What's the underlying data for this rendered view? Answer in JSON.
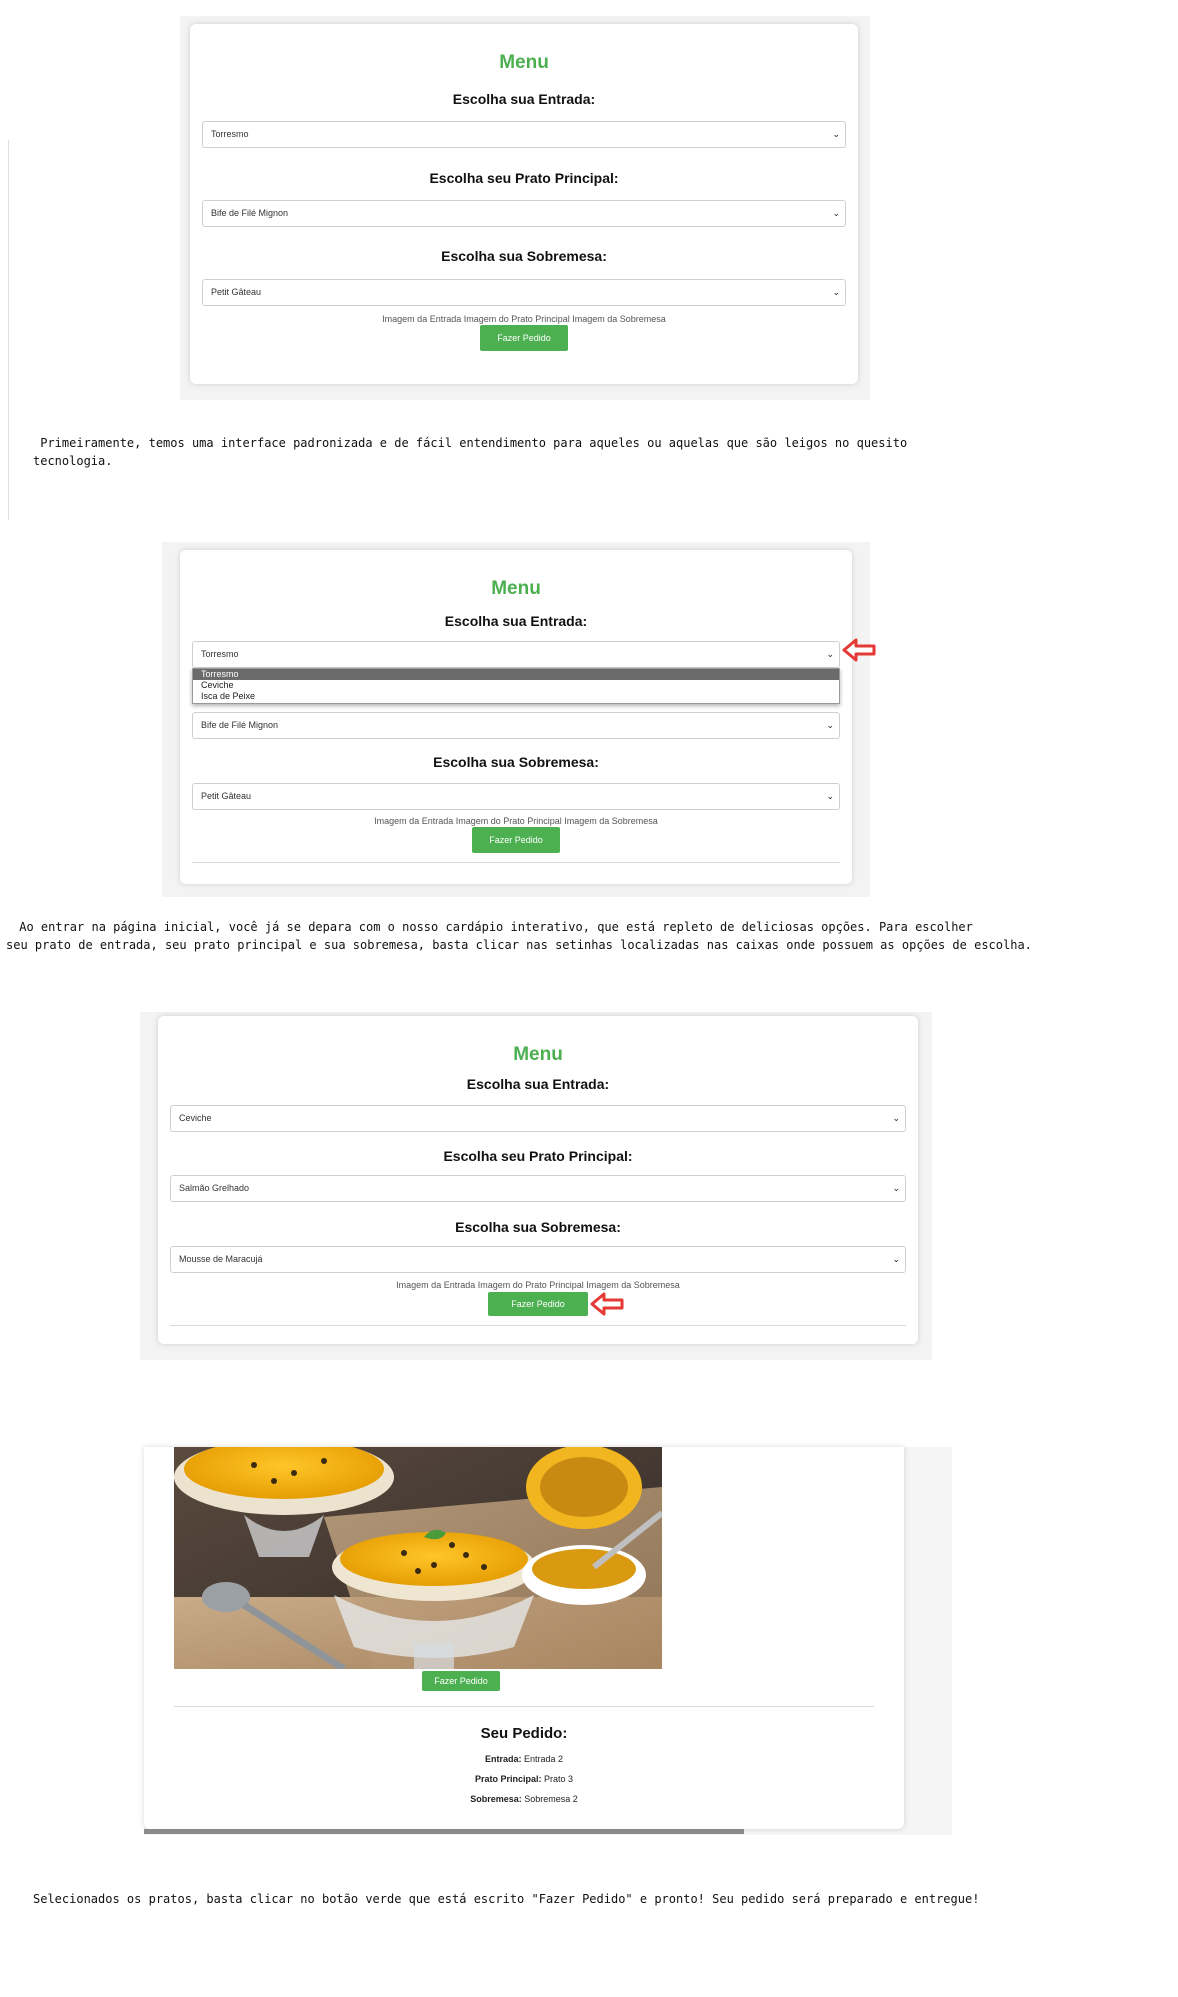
{
  "menu": {
    "title": "Menu",
    "label_entrada": "Escolha sua Entrada:",
    "label_principal": "Escolha seu Prato Principal:",
    "label_sobremesa": "Escolha sua Sobremesa:",
    "img_alts": "Imagem da Entrada Imagem do Prato Principal Imagem da Sobremesa",
    "order_button": "Fazer Pedido"
  },
  "shot1": {
    "entrada": "Torresmo",
    "principal": "Bife de Filé Mignon",
    "sobremesa": "Petit Gâteau"
  },
  "shot2": {
    "entrada": "Torresmo",
    "dropdown_options": [
      "Torresmo",
      "Ceviche",
      "Isca de Peixe"
    ],
    "principal": "Bife de Filé Mignon",
    "sobremesa": "Petit Gâteau"
  },
  "shot3": {
    "entrada": "Ceviche",
    "principal": "Salmão Grelhado",
    "sobremesa": "Mousse de Maracujá"
  },
  "shot4": {
    "order_button": "Fazer Pedido",
    "pedido_title": "Seu Pedido:",
    "entrada_label": "Entrada:",
    "entrada_value": "Entrada 2",
    "principal_label": "Prato Principal:",
    "principal_value": "Prato 3",
    "sobremesa_label": "Sobremesa:",
    "sobremesa_value": "Sobremesa 2",
    "scroll_fraction": 0.75
  },
  "captions": {
    "c1_line1": " Primeiramente, temos uma interface padronizada e de fácil entendimento para aqueles ou aquelas que são leigos no quesito",
    "c1_line2": "tecnologia.",
    "c2_line1": " Ao entrar na página inicial, você já se depara com o nosso cardápio interativo, que está repleto de deliciosas opções. Para escolher",
    "c2_line2": "seu prato de entrada, seu prato principal e sua sobremesa, basta clicar nas setinhas localizadas nas caixas onde possuem as opções de escolha.",
    "c3": "Selecionados os pratos, basta clicar no botão verde que está escrito \"Fazer Pedido\" e pronto! Seu pedido será preparado e entregue!"
  },
  "colors": {
    "green": "#4caf50",
    "arrow_red": "#e53935"
  },
  "icons": [
    "chevron-down-icon",
    "red-arrow-icon"
  ]
}
